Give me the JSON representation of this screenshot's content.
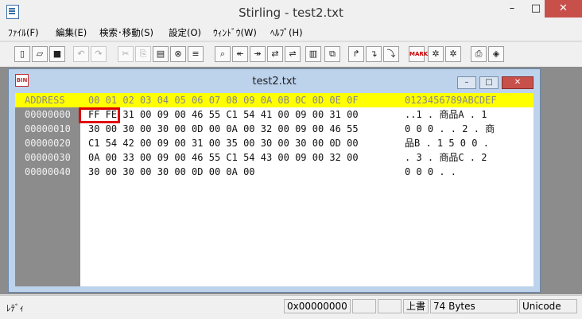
{
  "app": {
    "title": "Stirling - test2.txt",
    "min_label": "–",
    "max_label": "□",
    "close_label": "✕"
  },
  "menu": [
    "ﾌｧｲﾙ(F)",
    "編集(E)",
    "検索･移動(S)",
    "設定(O)",
    "ｳｨﾝﾄﾞｳ(W)",
    "ﾍﾙﾌﾟ(H)"
  ],
  "toolbar": {
    "icons": [
      "new-icon",
      "open-icon",
      "save-icon",
      "undo-icon",
      "redo-icon",
      "cut-icon",
      "copy-icon",
      "paste-icon",
      "delete-icon",
      "paste-special-icon",
      "find-icon",
      "find-prev-icon",
      "find-next-icon",
      "find-replace-icon",
      "compare-icon",
      "jump-icon",
      "insert-file-icon",
      "write-file-icon",
      "fill-icon",
      "mark-icon",
      "mark-next-icon",
      "mark-prev-icon",
      "print-icon",
      "settings-icon"
    ],
    "mark_label": "MARK"
  },
  "child": {
    "title": "test2.txt",
    "icon_label": "BIN",
    "min_label": "–",
    "max_label": "□",
    "close_label": "✕"
  },
  "hex": {
    "header": {
      "address": "ADDRESS",
      "bytes": "00 01 02 03 04 05 06 07 08 09 0A 0B 0C 0D 0E 0F",
      "text": "0123456789ABCDEF"
    },
    "rows": [
      {
        "address": "00000000",
        "bytes": "FF FE 31 00 09 00 46 55 C1 54 41 00 09 00 31 00",
        "text": "..1 . 商品A . 1"
      },
      {
        "address": "00000010",
        "bytes": "30 00 30 00 30 00 0D 00 0A 00 32 00 09 00 46 55",
        "text": "0 0 0 . . 2 . 商"
      },
      {
        "address": "00000020",
        "bytes": "C1 54 42 00 09 00 31 00 35 00 30 00 30 00 0D 00",
        "text": "品B . 1 5 0 0 ."
      },
      {
        "address": "00000030",
        "bytes": "0A 00 33 00 09 00 46 55 C1 54 43 00 09 00 32 00",
        "text": ". 3 . 商品C . 2"
      },
      {
        "address": "00000040",
        "bytes": "30 00 30 00 30 00 0D 00 0A 00",
        "text": "0 0 0 . ."
      }
    ]
  },
  "status": {
    "ready": "ﾚﾃﾞｨ",
    "offset": "0x00000000",
    "mode": "上書",
    "size": "74 Bytes",
    "encoding": "Unicode"
  }
}
